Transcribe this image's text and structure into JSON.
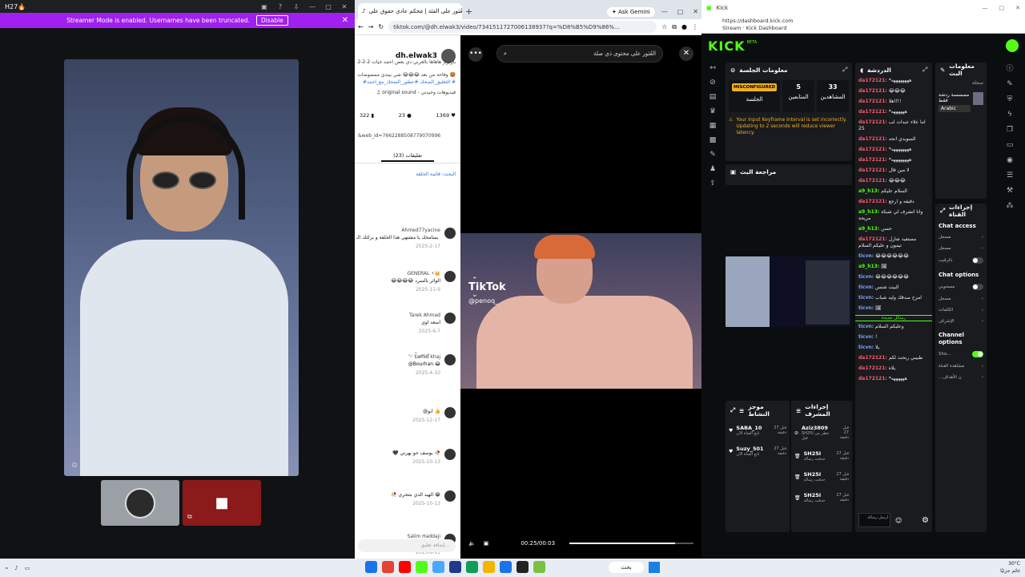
{
  "discord": {
    "title": "H27🔥",
    "banner": {
      "text": "Streamer Mode is enabled. Usernames have been truncated.",
      "button": "Disable"
    },
    "left_icons": [
      "+",
      "‹",
      "›",
      "‹",
      "›"
    ]
  },
  "tiktok": {
    "tab_title": "العُثور على الفئة | مَحكم عادي حقوق على...",
    "ask_gemini": "Ask Gemini",
    "url": "tiktok.com/@dh.elwak3/video/7341511727006138937?q=%D8%B5%D9%86%...",
    "username": "dh.elwak3",
    "caption_line1": "2-2-2 بارتزاز هاهاها بالعربي دي بعض احمد جيات",
    "caption_line2": "وقاحة من بعد 😂😂😂 شي بيندي ممضوضات 🥵",
    "caption_line3": "#التعليق_الضحك #عطور_الضحك_مع_احمد #",
    "sound": "♫ original sound - فيديوهات وحيدتي",
    "stats": {
      "likes": "1369",
      "comments": "23",
      "saves": "322"
    },
    "video_id": "&web_id=7662288508779070996",
    "comments_tab": "(23) تعليقات",
    "search_label": "البحث: قائمة الحلقة",
    "comments": [
      {
        "name": "Ahmed77yacine",
        "text": "الله يسامحك يا مشتهي هذا الحلقة و بركتك الـ",
        "date": "2025-2-17"
      },
      {
        "name": "GENERAL ⚡👑",
        "text": "😂😂😂😂 الواثر بالسرد",
        "date": "2025-11-9"
      },
      {
        "name": "Tarek Ahmad",
        "text": "أسعد اوي",
        "date": "2025-6-7"
      },
      {
        "name": "samid khaj",
        "text": "@Bourhan 😂",
        "date": "2025-4-10"
      },
      {
        "name": "",
        "text": "@أبو 👍",
        "date": "2025-12-17"
      },
      {
        "name": "",
        "text": "🖤 يوسف حو يهرني 🥀",
        "date": "2025-10-13"
      },
      {
        "name": "",
        "text": "🥀 الهيد الذي بتتحرى 😭",
        "date": "2025-10-13"
      },
      {
        "name": "Salim Haddaji",
        "text": "💗💗💗",
        "date": "2025-8-11"
      }
    ],
    "replies_label": "عرض 2 رد",
    "input_placeholder": "إضافة تعليق...",
    "search_placeholder": "العُثور على محتوى ذي صلة",
    "watermark": "TikTok",
    "handle": "@penoq_",
    "time": "00:25/00:03",
    "progress": 0.85
  },
  "kick": {
    "window_title": "Kick",
    "url_line1": "https://dashboard.kick.com",
    "url_line2": "Stream · Kick Dashboard",
    "logo": "KICK",
    "beta": "BETA",
    "session": {
      "title": "معلومات الجلسة",
      "badge": "MISCONFIGURED",
      "badge_label": "الجلسة",
      "followers": "5",
      "followers_label": "المتابعين",
      "viewers": "33",
      "viewers_label": "المشاهدين",
      "warning": "Your Input Keyframe Interval is set incorrectly. Updating to 2 seconds will reduce viewer latency."
    },
    "review": "مراجعة البث",
    "chat": {
      "title": "الدردشة",
      "messages": [
        {
          "user": "da172121:",
          "text": "*ههههههههه",
          "color": "red"
        },
        {
          "user": "da172121:",
          "text": "😂😂😂",
          "color": "red"
        },
        {
          "user": "da172121:",
          "text": "اهلا!!!",
          "color": "red"
        },
        {
          "user": "da172121:",
          "text": "*ههههههه",
          "color": "red"
        },
        {
          "user": "da172121:",
          "text": "اما علاء عبدات لب 25",
          "color": "red"
        },
        {
          "user": "da172121:",
          "text": "السويدي انحه",
          "color": "red"
        },
        {
          "user": "da172121:",
          "text": "*ههههههههه",
          "color": "red"
        },
        {
          "user": "da172121:",
          "text": "*ههههههههه",
          "color": "red"
        },
        {
          "user": "da172121:",
          "text": "لا مين قال",
          "color": "red"
        },
        {
          "user": "da172121:",
          "text": "😂😂😂",
          "color": "red"
        },
        {
          "user": "a9_h13:",
          "text": "السلام عليكم",
          "color": "green"
        },
        {
          "user": "da172121:",
          "text": "دقيقه و ارجع",
          "color": "red"
        },
        {
          "user": "a9_h13:",
          "text": "وانا اتشرف لي شبكة مريحة",
          "color": "green"
        },
        {
          "user": "a9_h13:",
          "text": "حسن",
          "color": "green"
        },
        {
          "user": "da172121:",
          "text": "مستفيد شارل تيمون و عليكم السلام",
          "color": "red"
        },
        {
          "user": "ticvn:",
          "text": "😂😂😂😂😂😂",
          "color": "blue"
        },
        {
          "user": "a9_h13:",
          "text": "🖼",
          "color": "green"
        },
        {
          "user": "ticvn:",
          "text": "😂😂😂😂😂😂",
          "color": "blue"
        },
        {
          "user": "ticvn:",
          "text": "البيت شنس",
          "color": "blue"
        },
        {
          "user": "ticvn:",
          "text": "امزح صدقك وليد شباب",
          "color": "blue"
        },
        {
          "user": "ticvn:",
          "text": "🖼",
          "color": "blue"
        }
      ],
      "separator": "رسائل جديدة",
      "messages2": [
        {
          "user": "ticvn:",
          "text": "وعليكم السلام",
          "color": "blue"
        },
        {
          "user": "ticvn:",
          "text": "!",
          "color": "blue"
        },
        {
          "user": "ticvn:",
          "text": "يلا",
          "color": "blue"
        },
        {
          "user": "da172121:",
          "text": "طبيبي ربحت لكم",
          "color": "red"
        },
        {
          "user": "da172121:",
          "text": "يلاه",
          "color": "red"
        },
        {
          "user": "da172121:",
          "text": "*ههههههه",
          "color": "red"
        }
      ],
      "send_placeholder": "ارسل رسالة"
    },
    "stream_info": {
      "title": "معلومات البث",
      "text": "مسسسة ردشة فقط",
      "lang": "Arabic",
      "name": "سجلة"
    },
    "actions": {
      "title": "إجراءات القناة",
      "chat_access": "Chat access",
      "rows1": [
        "مسجل",
        "مسجل",
        "بالرقيب"
      ],
      "chat_options": "Chat options",
      "rows2": [
        "مسحوبي",
        "مسجل",
        "الكلمات",
        "الإشراف"
      ],
      "channel_options": "Channel options",
      "show": "Sho...",
      "rows3": [
        "مشاهدة القناة",
        "...ن الأهداف"
      ]
    },
    "mods": {
      "title": "موجز النشاط",
      "rows": [
        {
          "name": "SABA_10",
          "sub": "تابع القناة الآن",
          "time": "قبل 27 دقيقة"
        },
        {
          "name": "Suzy_501",
          "sub": "تابع القناة الآن",
          "time": "قبل 27 دقيقة"
        }
      ]
    },
    "mod_actions": {
      "title": "إجراءات المشرف",
      "rows": [
        {
          "name": "Aziz3809",
          "sub": "SH25I حظر من قبل",
          "time": "قبل 27 دقيقة"
        },
        {
          "name": "SH25I",
          "sub": "حذفت رسالة",
          "time": "قبل 27 دقيقة"
        },
        {
          "name": "SH25I",
          "sub": "حذفت رسالة",
          "time": "قبل 27 دقيقة"
        },
        {
          "name": "SH25I",
          "sub": "حذفت رسالة",
          "time": "قبل 27 دقيقة"
        }
      ]
    }
  },
  "taskbar": {
    "search": "بحث",
    "tray_line1": "30°C",
    "tray_line2": "غائم جزئيًا",
    "icon_colors": [
      "#1a73e8",
      "#e34234",
      "#ff0000",
      "#53fc18",
      "#4aa8ff",
      "#1e3a8a",
      "#0f9d58",
      "#f4b400",
      "#1a73e8",
      "#222222",
      "#7ac143"
    ]
  },
  "colors": {
    "kick_green": "#53fc18",
    "discord_banner": "#a020f0",
    "warning": "#f2b01e"
  }
}
